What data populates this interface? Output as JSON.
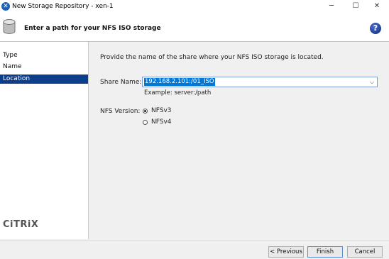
{
  "window": {
    "title": "New Storage Repository - xen-1"
  },
  "banner": {
    "title": "Enter a path for your NFS ISO storage"
  },
  "sidebar": {
    "items": [
      {
        "label": "Type",
        "active": false
      },
      {
        "label": "Name",
        "active": false
      },
      {
        "label": "Location",
        "active": true
      }
    ],
    "logo_text": "CiTRiX"
  },
  "main": {
    "intro": "Provide the name of the share where your NFS ISO storage is located.",
    "share_name_label": "Share Name:",
    "share_name_value": "192.168.2.101:/01_ISO",
    "example": "Example: server:/path",
    "nfs_version_label": "NFS Version:",
    "options": [
      {
        "label": "NFSv3",
        "selected": true
      },
      {
        "label": "NFSv4",
        "selected": false
      }
    ]
  },
  "footer": {
    "previous": "< Previous",
    "finish": "Finish",
    "cancel": "Cancel"
  },
  "colors": {
    "accent": "#0d3e8c",
    "selection": "#0078d7"
  },
  "icons": [
    "app-icon",
    "storage-disk-icon",
    "help-icon",
    "minimize-icon",
    "maximize-icon",
    "close-icon",
    "dropdown-arrow-icon"
  ]
}
